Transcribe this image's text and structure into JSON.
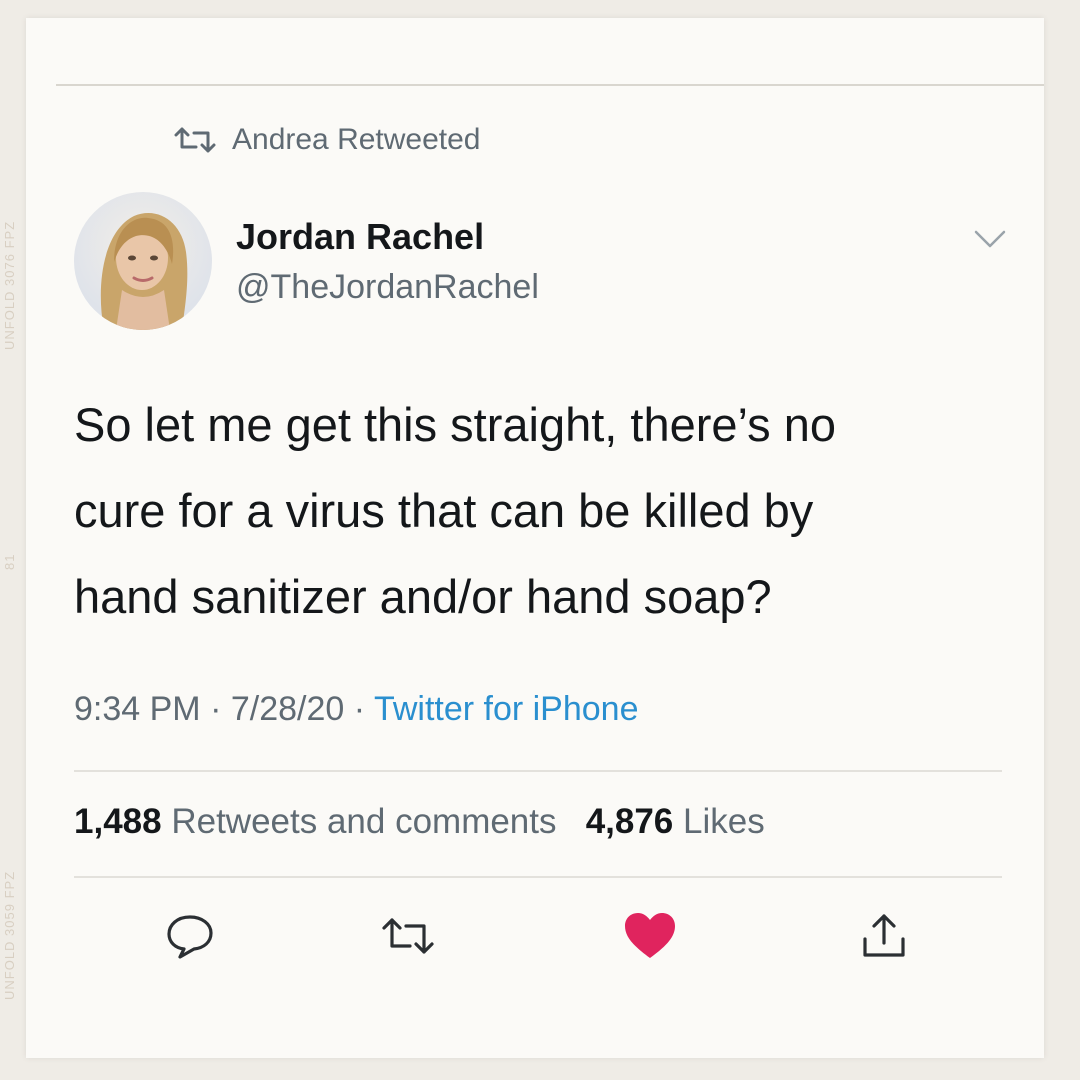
{
  "retweet_banner": {
    "label": "Andrea Retweeted",
    "icon": "retweet-icon"
  },
  "author": {
    "name": "Jordan Rachel",
    "handle": "@TheJordanRachel"
  },
  "tweet": {
    "lines": [
      "So let me get this straight, there’s no",
      "cure for a virus that can be killed by",
      "hand sanitizer and/or hand soap?"
    ]
  },
  "meta": {
    "time": "9:34 PM",
    "date": "7/28/20",
    "separator": "·",
    "source": "Twitter for iPhone"
  },
  "stats": {
    "retweets_count": "1,488",
    "retweets_label": "Retweets and comments",
    "likes_count": "4,876",
    "likes_label": "Likes"
  },
  "actions": [
    {
      "icon": "reply-icon"
    },
    {
      "icon": "retweet-icon"
    },
    {
      "icon": "like-heart-icon"
    },
    {
      "icon": "share-icon"
    }
  ],
  "colors": {
    "link": "#2a8fcf",
    "like": "#e0245e",
    "text": "#14171a",
    "secondary": "#5f6a73"
  },
  "side_marks": [
    "UNFOLD 3076 FPZ",
    "UNFOLD 3059 FPZ",
    "81"
  ]
}
